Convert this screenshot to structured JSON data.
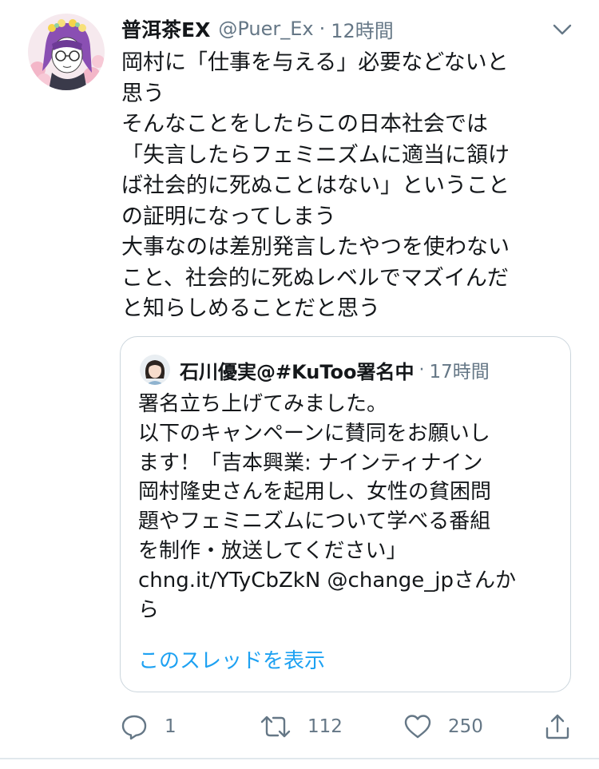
{
  "tweet": {
    "display_name": "普洱茶EX",
    "handle": "@Puer_Ex",
    "separator": "·",
    "time": "12時間",
    "body_lines": [
      "岡村に「仕事を与える」必要などないと",
      "思う",
      "そんなことをしたらこの日本社会では",
      "「失言したらフェミニズムに適当に頷け",
      "ば社会的に死ぬことはない」ということ",
      "の証明になってしまう",
      "大事なのは差別発言したやつを使わない",
      "こと、社会的に死ぬレベルでマズイんだ",
      "と知らしめることだと思う"
    ]
  },
  "quoted_tweet": {
    "display_name": "石川優実@#KuToo署名中",
    "separator": "·",
    "time": "17時間",
    "body_lines": [
      "署名立ち上げてみました。",
      "以下のキャンペーンに賛同をお願いし",
      "ます！「吉本興業: ナインティナイン",
      "岡村隆史さんを起用し、女性の貧困問",
      "題やフェミニズムについて学べる番組",
      "を制作・放送してください」",
      "chng.it/YTyCbZkN @change_jpさんか",
      "ら"
    ],
    "show_thread": "このスレッドを表示"
  },
  "actions": {
    "reply": {
      "icon": "reply-icon",
      "count": "1"
    },
    "retweet": {
      "icon": "retweet-icon",
      "count": "112"
    },
    "like": {
      "icon": "heart-icon",
      "count": "250"
    },
    "share": {
      "icon": "share-icon"
    }
  },
  "colors": {
    "text": "#14171a",
    "secondary": "#657786",
    "link": "#1da1f2",
    "border": "#ccd6dd"
  }
}
